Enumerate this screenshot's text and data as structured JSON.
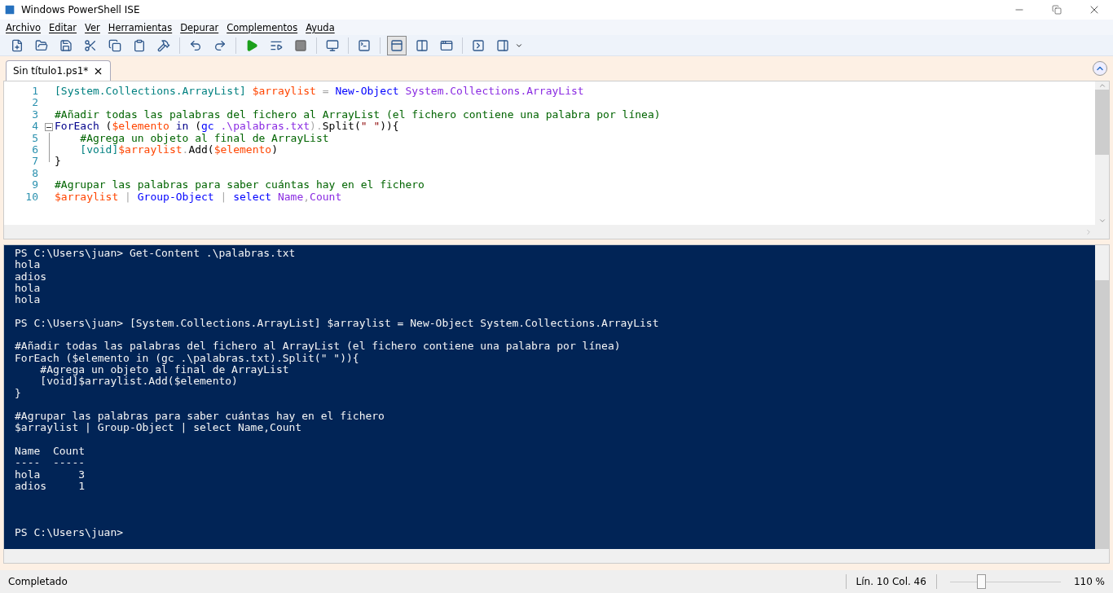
{
  "window": {
    "title": "Windows PowerShell ISE"
  },
  "menu": [
    {
      "label": "Archivo"
    },
    {
      "label": "Editar"
    },
    {
      "label": "Ver"
    },
    {
      "label": "Herramientas"
    },
    {
      "label": "Depurar"
    },
    {
      "label": "Complementos"
    },
    {
      "label": "Ayuda"
    }
  ],
  "tabs": [
    {
      "label": "Sin título1.ps1*",
      "selected": true
    }
  ],
  "editor": {
    "lines": [
      {
        "number": "1",
        "fold_start": false,
        "in_fold": false,
        "tokens": [
          {
            "text": "[System.Collections.ArrayList]",
            "kind": "type"
          },
          {
            "text": " $arraylist",
            "kind": "variable"
          },
          {
            "text": " = ",
            "kind": "operator"
          },
          {
            "text": "New-Object",
            "kind": "command"
          },
          {
            "text": " System.Collections.ArrayList",
            "kind": "argument"
          }
        ]
      },
      {
        "number": "2",
        "fold_start": false,
        "in_fold": false
      },
      {
        "number": "3",
        "fold_start": false,
        "in_fold": false,
        "tokens": [
          {
            "text": "#Añadir todas las palabras del fichero al ArrayList (el fichero contiene una palabra por línea)",
            "kind": "comment"
          }
        ]
      },
      {
        "number": "4",
        "fold_start": true,
        "in_fold": false,
        "tokens": [
          {
            "text": "ForEach",
            "kind": "keyword"
          },
          {
            "text": " (",
            "kind": "plain"
          },
          {
            "text": "$elemento",
            "kind": "variable"
          },
          {
            "text": " in ",
            "kind": "keyword"
          },
          {
            "text": "(",
            "kind": "plain"
          },
          {
            "text": "gc",
            "kind": "command"
          },
          {
            "text": " .\\palabras.txt",
            "kind": "argument"
          },
          {
            "text": ").",
            "kind": "operator"
          },
          {
            "text": "Split(",
            "kind": "plain"
          },
          {
            "text": "\" \"",
            "kind": "string"
          },
          {
            "text": ")){",
            "kind": "plain"
          }
        ]
      },
      {
        "number": "5",
        "fold_start": false,
        "in_fold": true,
        "tokens": [
          {
            "text": "    #Agrega un objeto al final de ArrayList",
            "kind": "comment"
          }
        ]
      },
      {
        "number": "6",
        "fold_start": false,
        "in_fold": true,
        "tokens": [
          {
            "text": "    [void]",
            "kind": "type"
          },
          {
            "text": "$arraylist",
            "kind": "variable"
          },
          {
            "text": ".",
            "kind": "operator"
          },
          {
            "text": "Add(",
            "kind": "plain"
          },
          {
            "text": "$elemento",
            "kind": "variable"
          },
          {
            "text": ")",
            "kind": "plain"
          }
        ]
      },
      {
        "number": "7",
        "fold_start": false,
        "in_fold": true,
        "tokens": [
          {
            "text": "}",
            "kind": "plain"
          }
        ]
      },
      {
        "number": "8",
        "fold_start": false,
        "in_fold": false
      },
      {
        "number": "9",
        "fold_start": false,
        "in_fold": false,
        "tokens": [
          {
            "text": "#Agrupar las palabras para saber cuántas hay en el fichero",
            "kind": "comment"
          }
        ]
      },
      {
        "number": "10",
        "fold_start": false,
        "in_fold": false,
        "tokens": [
          {
            "text": "$arraylist",
            "kind": "variable"
          },
          {
            "text": " | ",
            "kind": "operator"
          },
          {
            "text": "Group-Object",
            "kind": "command"
          },
          {
            "text": " | ",
            "kind": "operator"
          },
          {
            "text": "select",
            "kind": "command"
          },
          {
            "text": " Name",
            "kind": "argument"
          },
          {
            "text": ",",
            "kind": "operator"
          },
          {
            "text": "Count",
            "kind": "argument"
          }
        ]
      }
    ]
  },
  "console": {
    "lines": [
      {
        "kind": "text",
        "text": "PS C:\\Users\\juan> Get-Content .\\palabras.txt"
      },
      {
        "kind": "text",
        "text": "hola"
      },
      {
        "kind": "text",
        "text": "adios"
      },
      {
        "kind": "text",
        "text": "hola"
      },
      {
        "kind": "text",
        "text": "hola"
      },
      {
        "kind": "blank"
      },
      {
        "kind": "text",
        "text": "PS C:\\Users\\juan> [System.Collections.ArrayList] $arraylist = New-Object System.Collections.ArrayList"
      },
      {
        "kind": "blank"
      },
      {
        "kind": "text",
        "text": "#Añadir todas las palabras del fichero al ArrayList (el fichero contiene una palabra por línea)"
      },
      {
        "kind": "text",
        "text": "ForEach ($elemento in (gc .\\palabras.txt).Split(\" \")){"
      },
      {
        "kind": "text",
        "text": "    #Agrega un objeto al final de ArrayList"
      },
      {
        "kind": "text",
        "text": "    [void]$arraylist.Add($elemento)"
      },
      {
        "kind": "text",
        "text": "}"
      },
      {
        "kind": "blank"
      },
      {
        "kind": "text",
        "text": "#Agrupar las palabras para saber cuántas hay en el fichero"
      },
      {
        "kind": "text",
        "text": "$arraylist | Group-Object | select Name,Count"
      },
      {
        "kind": "blank"
      },
      {
        "kind": "text",
        "text": "Name  Count"
      },
      {
        "kind": "text",
        "text": "----  -----"
      },
      {
        "kind": "text",
        "text": "hola      3"
      },
      {
        "kind": "text",
        "text": "adios     1"
      },
      {
        "kind": "blank"
      },
      {
        "kind": "blank"
      },
      {
        "kind": "blank"
      },
      {
        "kind": "text",
        "text": "PS C:\\Users\\juan>"
      }
    ]
  },
  "status_bar": {
    "status": "Completado",
    "position": "Lín. 10 Col. 46",
    "zoom": {
      "level": 0.24,
      "reading": "110 %"
    }
  }
}
